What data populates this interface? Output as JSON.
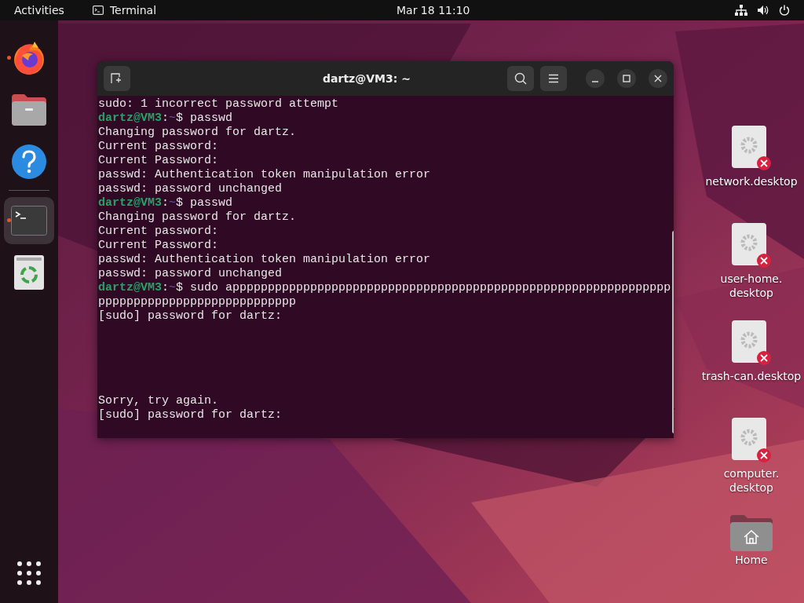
{
  "top_bar": {
    "activities": "Activities",
    "app_name": "Terminal",
    "clock": "Mar 18  11:10"
  },
  "dock": [
    {
      "kind": "browser",
      "running": true,
      "selected": false
    },
    {
      "kind": "files",
      "running": false,
      "selected": false
    },
    {
      "kind": "help",
      "running": false,
      "selected": false
    },
    {
      "kind": "terminal",
      "running": true,
      "selected": true
    },
    {
      "kind": "trash",
      "running": false,
      "selected": false
    }
  ],
  "terminal": {
    "title": "dartz@VM3: ~",
    "lines": [
      {
        "kind": "output",
        "text": "sudo: 1 incorrect password attempt"
      },
      {
        "kind": "prompt",
        "user": "dartz@VM3",
        "sep": ":",
        "path": "~",
        "command": "$ passwd"
      },
      {
        "kind": "output",
        "text": "Changing password for dartz."
      },
      {
        "kind": "output",
        "text": "Current password:"
      },
      {
        "kind": "output",
        "text": "Current Password:"
      },
      {
        "kind": "output",
        "text": "passwd: Authentication token manipulation error"
      },
      {
        "kind": "output",
        "text": "passwd: password unchanged"
      },
      {
        "kind": "prompt",
        "user": "dartz@VM3",
        "sep": ":",
        "path": "~",
        "command": "$ passwd"
      },
      {
        "kind": "output",
        "text": "Changing password for dartz."
      },
      {
        "kind": "output",
        "text": "Current password:"
      },
      {
        "kind": "output",
        "text": "Current Password:"
      },
      {
        "kind": "output",
        "text": "passwd: Authentication token manipulation error"
      },
      {
        "kind": "output",
        "text": "passwd: password unchanged"
      },
      {
        "kind": "prompt",
        "user": "dartz@VM3",
        "sep": ":",
        "path": "~",
        "command": "$ sudo apppppppppppppppppppppppppppppppppppppppppppppppppppppppppppppp"
      },
      {
        "kind": "output",
        "text": "pppppppppppppppppppppppppppp"
      },
      {
        "kind": "output",
        "text": "[sudo] password for dartz:"
      },
      {
        "kind": "blank"
      },
      {
        "kind": "blank"
      },
      {
        "kind": "blank"
      },
      {
        "kind": "blank"
      },
      {
        "kind": "blank"
      },
      {
        "kind": "output",
        "text": "Sorry, try again."
      },
      {
        "kind": "output",
        "text": "[sudo] password for dartz:"
      }
    ]
  },
  "desktop_icons": [
    {
      "kind": "broken-file",
      "label": "network.desktop"
    },
    {
      "kind": "broken-file",
      "label": "user-home.\ndesktop"
    },
    {
      "kind": "broken-file",
      "label": "trash-can.desktop"
    },
    {
      "kind": "broken-file",
      "label": "computer.\ndesktop"
    },
    {
      "kind": "folder",
      "label": "Home"
    }
  ]
}
